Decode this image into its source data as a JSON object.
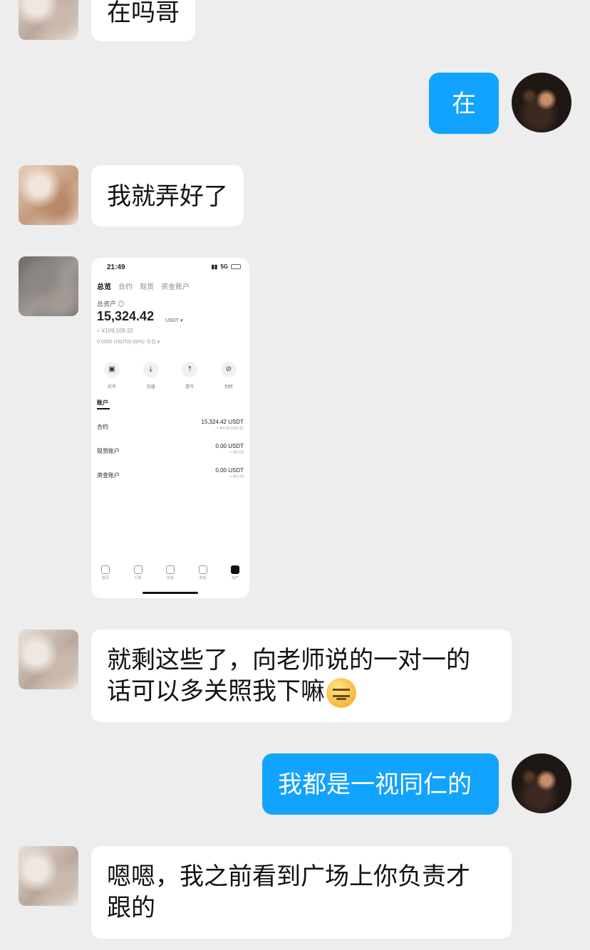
{
  "messages": [
    {
      "from": "other",
      "text": "在吗哥"
    },
    {
      "from": "me",
      "text": "在"
    },
    {
      "from": "other",
      "text": "我就弄好了"
    },
    {
      "from": "other",
      "type": "image"
    },
    {
      "from": "other",
      "text": "就剩这些了，向老师说的一对一的\n话可以多关照我下嘛",
      "emoji": "smirk-face-emoji"
    },
    {
      "from": "me",
      "text": "我都是一视同仁的"
    },
    {
      "from": "other",
      "text": "嗯嗯，我之前看到广场上你负责才\n跟的"
    }
  ],
  "screenshot": {
    "time": "21:49",
    "network": "5G",
    "tabs": [
      "总览",
      "合约",
      "现货",
      "资金账户"
    ],
    "total_label": "总资产 ◎",
    "total_value": "15,324.42",
    "total_unit": "USDT ▾",
    "cny_value": "≈ ¥109,109.32",
    "pnl_text": "0.0000 USDT(0.00%) 今日 ▾",
    "actions": [
      {
        "icon": "wallet-icon",
        "label": "买币"
      },
      {
        "icon": "deposit-icon",
        "label": "充值"
      },
      {
        "icon": "withdraw-icon",
        "label": "提币"
      },
      {
        "icon": "transfer-icon",
        "label": "划转"
      }
    ],
    "accounts_title": "账户",
    "accounts": [
      {
        "name": "合约",
        "amount": "15,324.42 USDT",
        "sub": "≈ ¥109,109.32"
      },
      {
        "name": "现货账户",
        "amount": "0.00 USDT",
        "sub": "≈ ¥0.00"
      },
      {
        "name": "资金账户",
        "amount": "0.00 USDT",
        "sub": "≈ ¥0.00"
      }
    ],
    "nav": [
      "首页",
      "行情",
      "交易",
      "发现",
      "资产"
    ]
  }
}
